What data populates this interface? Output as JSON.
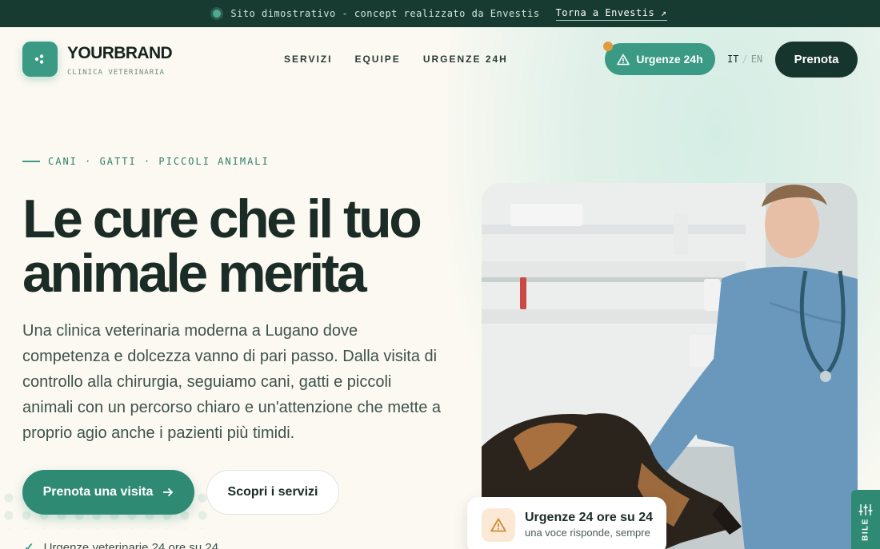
{
  "topbar": {
    "notice": "Sito dimostrativo - concept realizzato da Envestis",
    "link_label": "Torna a Envestis",
    "link_icon": "arrow-up-right-icon"
  },
  "brand": {
    "name": "YOURBRAND",
    "subtitle": "CLINICA VETERINARIA",
    "logo_icon": "paw-dots-icon"
  },
  "nav": {
    "items": [
      {
        "label": "SERVIZI"
      },
      {
        "label": "EQUIPE"
      },
      {
        "label": "URGENZE 24H"
      }
    ]
  },
  "header": {
    "urgent_label": "Urgenze 24h",
    "urgent_icon": "warning-triangle-icon",
    "lang_active": "IT",
    "lang_other": "EN",
    "lang_separator": "/",
    "book_label": "Prenota"
  },
  "hero": {
    "eyebrow": "CANI · GATTI · PICCOLI ANIMALI",
    "headline_line1": "Le cure che il tuo",
    "headline_line2": "animale merita",
    "description": "Una clinica veterinaria moderna a Lugano dove competenza e dolcezza vanno di pari passo. Dalla visita di controllo alla chirurgia, seguiamo cani, gatti e piccoli animali con un percorso chiaro e un'attenzione che mette a proprio agio anche i pazienti più timidi.",
    "cta_primary": "Prenota una visita",
    "cta_primary_icon": "arrow-right-icon",
    "cta_secondary": "Scopri i servizi",
    "check_item": "Urgenze veterinarie 24 ore su 24",
    "check_icon": "check-icon"
  },
  "photo": {
    "subject": "vet-with-dog-photo"
  },
  "urgent_card": {
    "title": "Urgenze 24 ore su 24",
    "subtitle": "una voce risponde, sempre",
    "icon": "warning-triangle-icon"
  },
  "side_tab": {
    "label": "BILE",
    "icon": "sliders-icon"
  },
  "colors": {
    "accent": "#3a9a83",
    "dark": "#16352c",
    "topbar": "#173b31",
    "background": "#fbf9f2",
    "warning": "#e39a3c"
  }
}
